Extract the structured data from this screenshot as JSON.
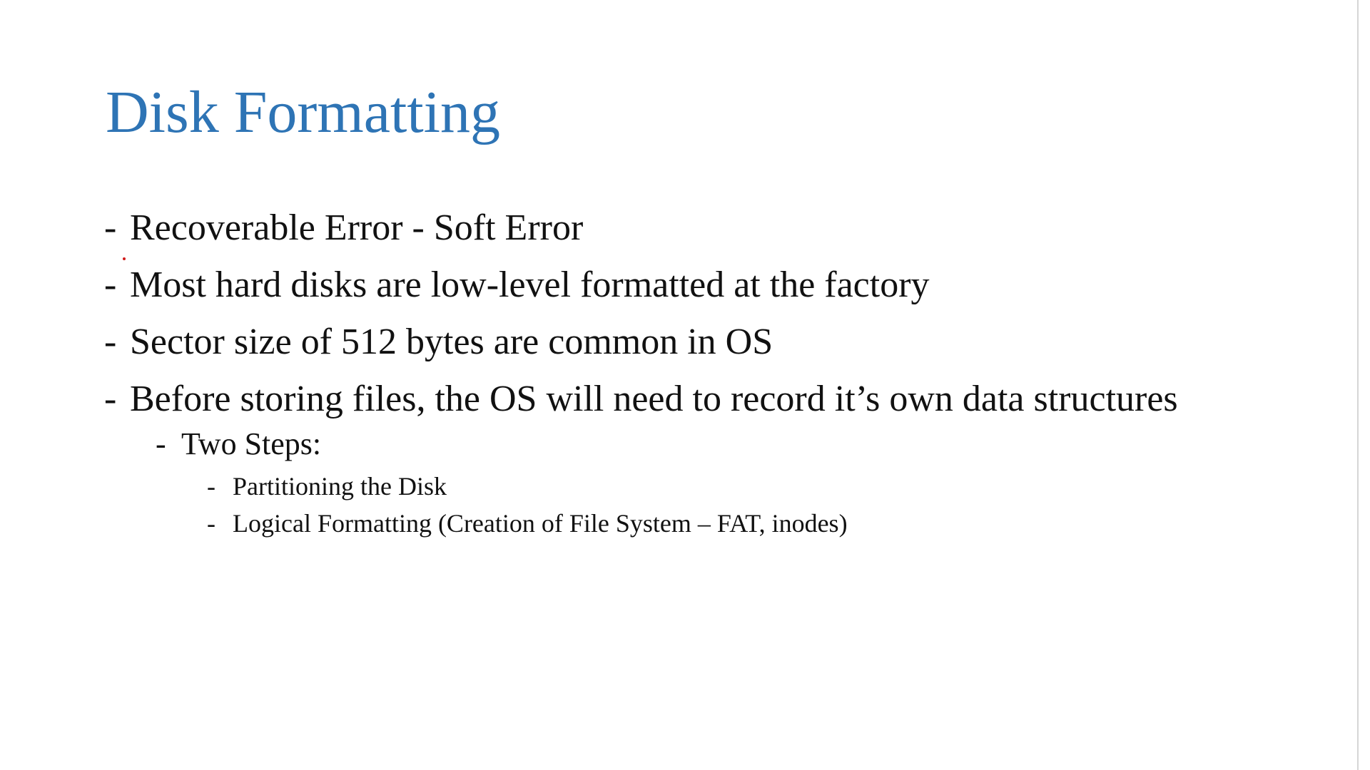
{
  "slide": {
    "title": "Disk Formatting",
    "title_color": "#2e74b5",
    "bullet_marker": "-",
    "bullets": [
      "Recoverable Error - Soft Error",
      "Most hard disks are low-level formatted at the factory",
      "Sector size of 512 bytes are common in OS",
      "Before storing files, the OS will need to record it’s own data structures"
    ],
    "sub_bullet": "Two Steps:",
    "sub_sub_bullets": [
      "Partitioning the Disk",
      "Logical Formatting (Creation of File System – FAT, inodes)"
    ]
  }
}
